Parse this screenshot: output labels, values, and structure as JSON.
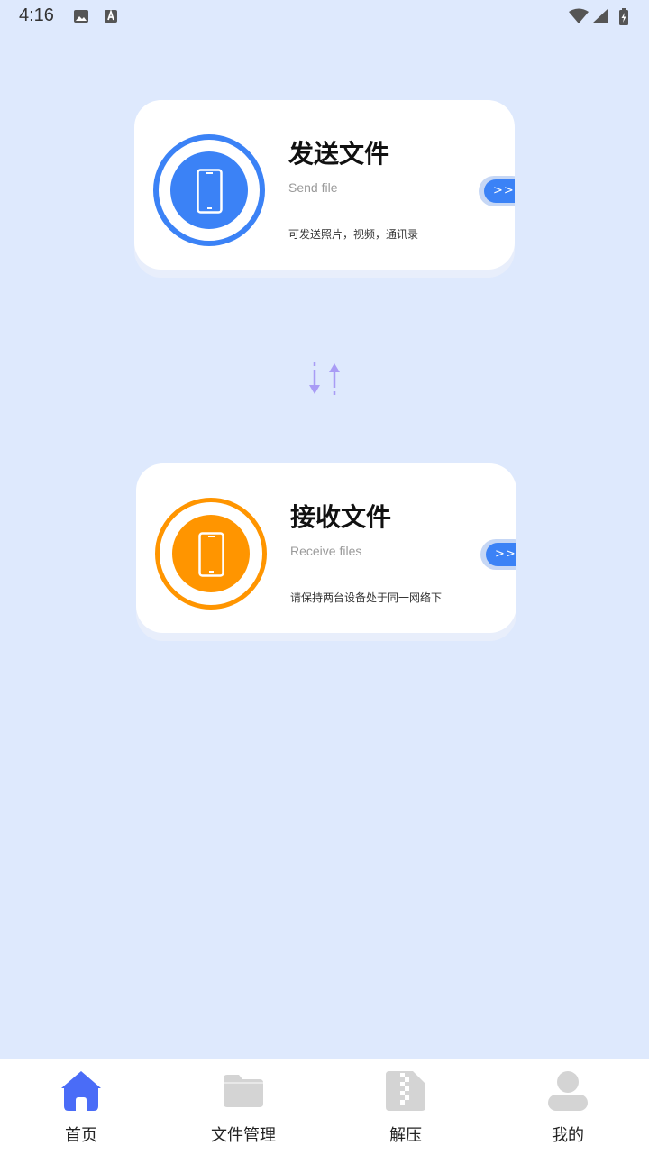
{
  "status": {
    "time": "4:16"
  },
  "send_card": {
    "title": "发送文件",
    "subtitle": "Send file",
    "description": "可发送照片，视频，通讯录",
    "go_label": ">>>",
    "accent": "#3b82f6"
  },
  "receive_card": {
    "title": "接收文件",
    "subtitle": "Receive files",
    "description": "请保持两台设备处于同一网络下",
    "go_label": ">>>",
    "accent": "#ff9500"
  },
  "nav": {
    "items": [
      {
        "label": "首页",
        "icon": "home-icon",
        "active": true
      },
      {
        "label": "文件管理",
        "icon": "folder-icon",
        "active": false
      },
      {
        "label": "解压",
        "icon": "zip-icon",
        "active": false
      },
      {
        "label": "我的",
        "icon": "user-icon",
        "active": false
      }
    ],
    "active_color": "#4a6cf7",
    "inactive_color": "#d4d4d4"
  }
}
